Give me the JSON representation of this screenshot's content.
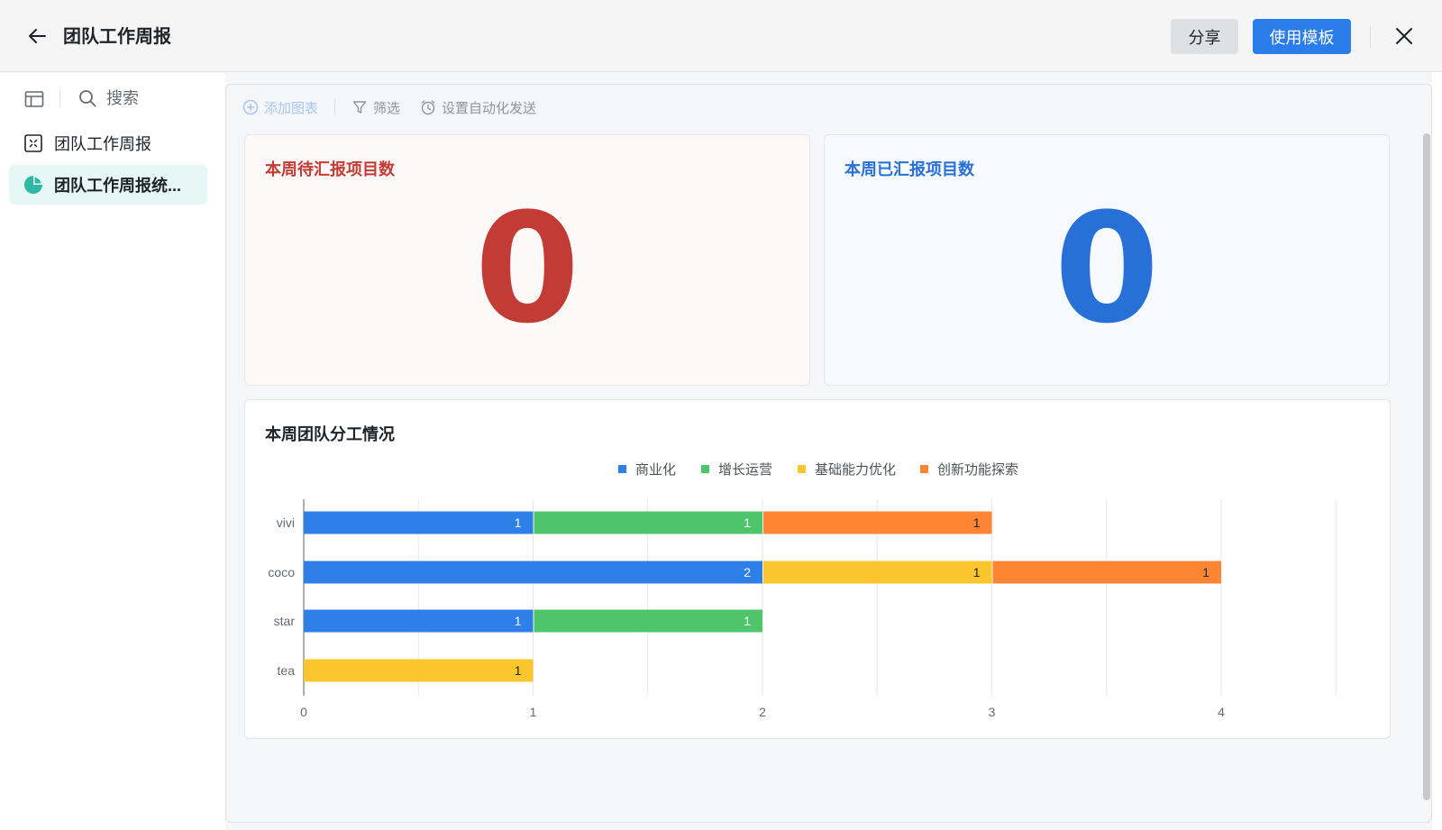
{
  "header": {
    "title": "团队工作周报",
    "share_label": "分享",
    "use_template_label": "使用模板"
  },
  "sidebar": {
    "search_label": "搜索",
    "items": [
      {
        "label": "团队工作周报",
        "icon": "table-doc-icon",
        "active": false
      },
      {
        "label": "团队工作周报统...",
        "icon": "pie-chart-icon",
        "active": true
      }
    ]
  },
  "toolbar": {
    "add_chart_label": "添加图表",
    "filter_label": "筛选",
    "auto_send_label": "设置自动化发送"
  },
  "cards": {
    "pending": {
      "title": "本周待汇报项目数",
      "value": "0",
      "color": "#c23b35"
    },
    "reported": {
      "title": "本周已汇报项目数",
      "value": "0",
      "color": "#2670d8"
    }
  },
  "chart_card": {
    "title": "本周团队分工情况"
  },
  "colors": {
    "accent": "#2b7de9",
    "pending_bg": "#fdf9f8",
    "reported_bg": "#f6f9fd"
  },
  "chart_data": {
    "type": "bar",
    "orientation": "horizontal",
    "stacked": true,
    "title": "本周团队分工情况",
    "categories": [
      "vivi",
      "coco",
      "star",
      "tea"
    ],
    "series": [
      {
        "name": "商业化",
        "color": "#2f7fe8",
        "values": [
          1,
          2,
          1,
          0
        ]
      },
      {
        "name": "增长运营",
        "color": "#4fc56b",
        "values": [
          1,
          0,
          1,
          0
        ]
      },
      {
        "name": "基础能力优化",
        "color": "#fbc52e",
        "values": [
          0,
          1,
          0,
          1
        ]
      },
      {
        "name": "创新功能探索",
        "color": "#fd8534",
        "values": [
          1,
          1,
          0,
          0
        ]
      }
    ],
    "xlim": [
      0,
      4.5
    ],
    "x_ticks": [
      0,
      1,
      2,
      3,
      4
    ],
    "grid": true,
    "legend_position": "top-center",
    "show_data_labels": true
  }
}
